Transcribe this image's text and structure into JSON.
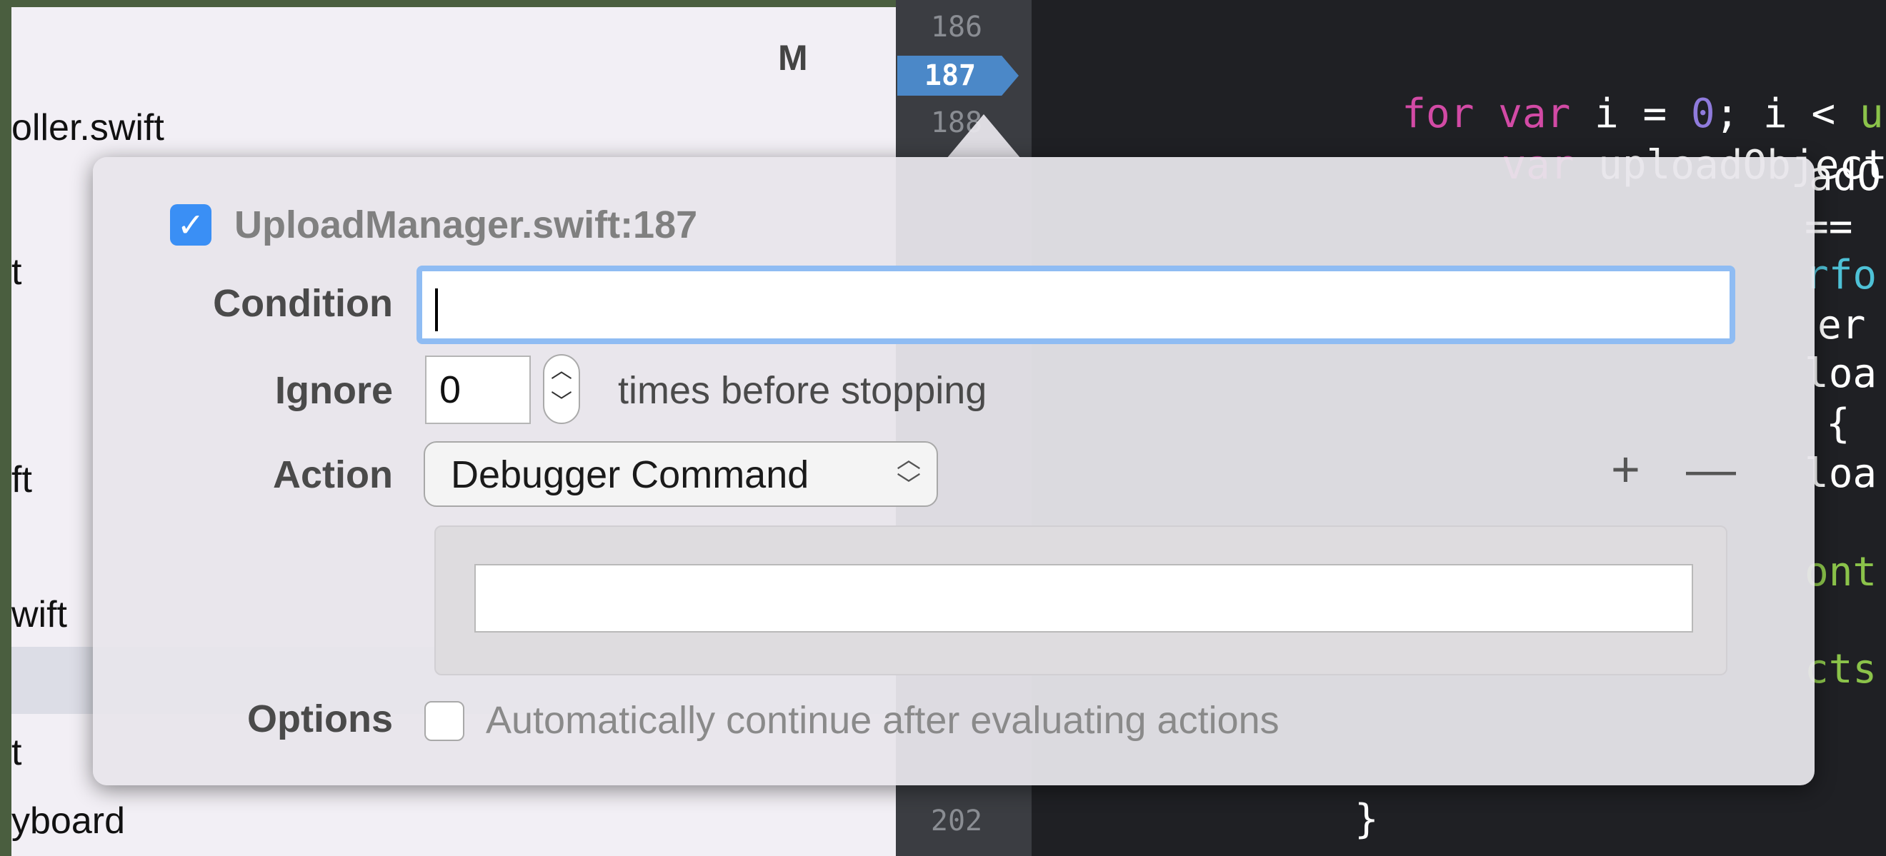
{
  "navigator": {
    "badge": "M",
    "rows": [
      "oller.swift",
      "t",
      "ft",
      "wift",
      "t",
      "yboard"
    ]
  },
  "gutter": {
    "line_numbers": [
      "186",
      "187",
      "188",
      "202"
    ]
  },
  "code": {
    "line1": {
      "kw1": "for",
      "kw2": "var",
      "plain1": " i = ",
      "num": "0",
      "plain2": "; i < ",
      "fn": "upload"
    },
    "line2": {
      "kw": "var",
      "plain": " uploadObject = up"
    },
    "fragments": [
      "adO",
      "==",
      "rfo",
      "er",
      "loa",
      "{",
      "loa",
      "ont",
      "cts"
    ],
    "brace": "}"
  },
  "popover": {
    "breakpoint_enabled": true,
    "title": "UploadManager.swift:187",
    "condition": {
      "label": "Condition",
      "value": ""
    },
    "ignore": {
      "label": "Ignore",
      "value": "0",
      "suffix": "times before stopping"
    },
    "action": {
      "label": "Action",
      "selected": "Debugger Command",
      "command_value": ""
    },
    "options": {
      "label": "Options",
      "checked": false,
      "text": "Automatically continue after evaluating actions"
    },
    "add_label": "+",
    "remove_label": "—"
  },
  "colors": {
    "breakpoint": "#4b88c8",
    "checkbox_accent": "#3a8ff5",
    "focus_ring": "#8fbcf3",
    "editor_bg": "#1f2024",
    "keyword": "#d24aa5",
    "number": "#8f7bdc",
    "function": "#8bc34a",
    "property": "#4ec1d6"
  },
  "icons": {
    "checkbox": "checkmark-icon",
    "stepper": "stepper-arrows-icon",
    "select": "select-arrows-icon"
  }
}
